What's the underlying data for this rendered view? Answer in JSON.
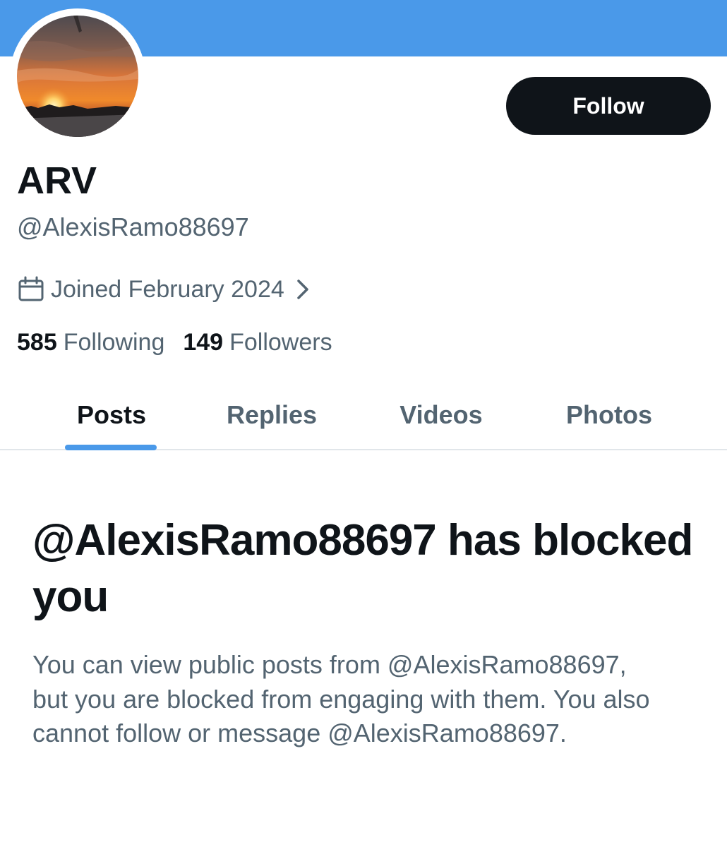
{
  "profile": {
    "display_name": "ARV",
    "handle": "@AlexisRamo88697",
    "joined": "Joined February 2024",
    "avatar_icon": "sunset-photo-avatar"
  },
  "actions": {
    "follow_label": "Follow"
  },
  "stats": {
    "following_count": "585",
    "following_label": "Following",
    "followers_count": "149",
    "followers_label": "Followers"
  },
  "tabs": [
    {
      "label": "Posts",
      "active": true
    },
    {
      "label": "Replies",
      "active": false
    },
    {
      "label": "Videos",
      "active": false
    },
    {
      "label": "Photos",
      "active": false
    }
  ],
  "blocked": {
    "title": "@AlexisRamo88697 has blocked you",
    "body": "You can view public posts from @AlexisRamo88697, but you are blocked from engaging with them. You also cannot follow or message @AlexisRamo88697."
  },
  "colors": {
    "banner": "#4a99e9",
    "accent": "#4a99e9",
    "primary_text": "#0f1419",
    "secondary_text": "#536471",
    "follow_button_bg": "#0f1419",
    "divider": "#e1e6ea"
  },
  "icons": {
    "calendar": "calendar-icon",
    "chevron": "chevron-right-icon"
  }
}
